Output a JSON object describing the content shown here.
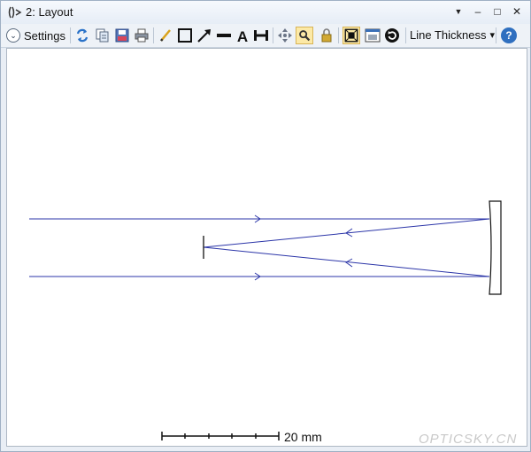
{
  "window": {
    "title": "2: Layout",
    "buttons": {
      "dropdown": "▼",
      "minimize": "–",
      "maximize": "□",
      "close": "✕"
    }
  },
  "toolbar": {
    "settings_label": "Settings",
    "line_thickness_label": "Line Thickness",
    "line_thickness_caret": "▾",
    "help_label": "?",
    "icons": [
      "refresh-icon",
      "copy-icon",
      "save-icon",
      "print-icon",
      "pencil-icon",
      "rectangle-icon",
      "arrow-icon",
      "line-icon",
      "text-icon",
      "dimension-icon",
      "pan-icon",
      "zoom-icon",
      "lock-icon",
      "fit-icon",
      "window-icon",
      "rotate-icon"
    ]
  },
  "scale_bar": {
    "label": "20 mm"
  },
  "watermark": "OPTICSKY.CN",
  "colors": {
    "ray": "#2b35a8",
    "active_tool": "#fce9a6"
  }
}
